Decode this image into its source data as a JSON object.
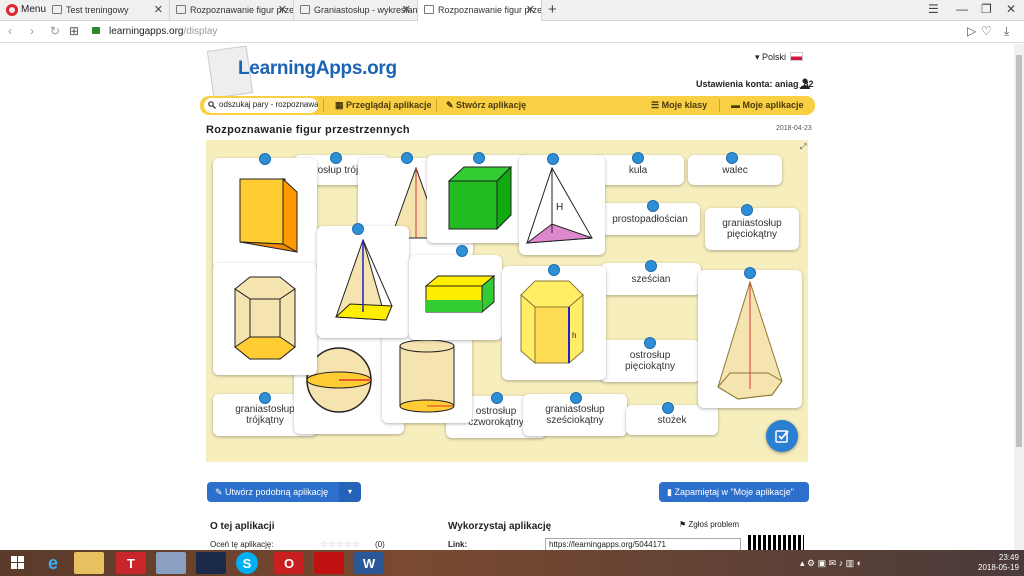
{
  "browser": {
    "menu_label": "Menu",
    "tabs": [
      {
        "label": "Test treningowy"
      },
      {
        "label": "Rozpoznawanie figur przestrzennych"
      },
      {
        "label": "Graniastosłup - wykreślanka"
      },
      {
        "label": "Rozpoznawanie figur przestrzennych"
      }
    ],
    "url_host": "learningapps.org",
    "url_path": "/display"
  },
  "header": {
    "logo": "LearningApps.org",
    "language": "Polski",
    "account": "Ustawienia konta: aniag_82"
  },
  "nav": {
    "search_value": "odszukaj pary - rozpoznawanie",
    "browse": "Przeglądaj aplikacje",
    "create": "Stwórz aplikację",
    "my_classes": "Moje klasy",
    "my_apps": "Moje aplikacje"
  },
  "app": {
    "title": "Rozpoznawanie figur przestrzennych",
    "date": "2018-04-23",
    "cards": {
      "c1": "ostrosłup trójkątny",
      "c2": "kula",
      "c3": "walec",
      "c4": "prostopadłościan",
      "c5": "graniastosłup pięciokątny",
      "c6": "sześcian",
      "c7": "ostrosłup pięciokątny",
      "c8": "graniastosłup trójkątny",
      "c9": "ostrosłup czworokątny",
      "c10": "graniastosłup sześciokątny",
      "c11": "stożek"
    },
    "shape_labels": {
      "H": "H",
      "h": "h"
    }
  },
  "actions": {
    "create_similar": "Utwórz podobną aplikację",
    "save_to_my": "Zapamiętaj w \"Moje aplikacje\""
  },
  "footer": {
    "about_title": "O tej aplikacji",
    "rate_label": "Oceń tę aplikację:",
    "rate_count": "(0)",
    "use_title": "Wykorzystaj aplikację",
    "report": "Zgłoś problem",
    "link_label": "Link:",
    "link_value": "https://learningapps.org/5044171"
  },
  "taskbar": {
    "time": "23:49",
    "date": "2018-05-19"
  },
  "colors": {
    "accent_blue": "#2c6fcc",
    "nav_yellow": "#f9cf43",
    "game_bg": "#f7eebd",
    "dot_blue": "#2f8fd6"
  }
}
